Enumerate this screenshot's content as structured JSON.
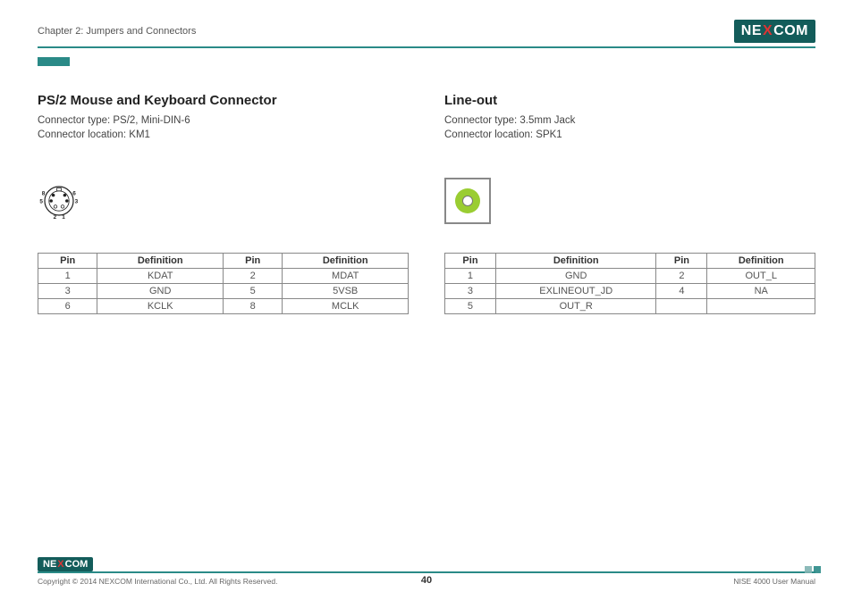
{
  "header": {
    "chapter_label": "Chapter 2: Jumpers and Connectors",
    "brand_left": "NE",
    "brand_x": "X",
    "brand_right": "COM"
  },
  "left_section": {
    "title": "PS/2 Mouse and Keyboard Connector",
    "connector_type": "Connector type: PS/2, Mini-DIN-6",
    "connector_location": "Connector location: KM1",
    "diagram_labels": {
      "p8": "8",
      "p6": "6",
      "p5": "5",
      "p3": "3",
      "p2": "2",
      "p1": "1"
    },
    "headers": {
      "pin": "Pin",
      "definition": "Definition"
    },
    "rows": [
      {
        "pin_a": "1",
        "def_a": "KDAT",
        "pin_b": "2",
        "def_b": "MDAT"
      },
      {
        "pin_a": "3",
        "def_a": "GND",
        "pin_b": "5",
        "def_b": "5VSB"
      },
      {
        "pin_a": "6",
        "def_a": "KCLK",
        "pin_b": "8",
        "def_b": "MCLK"
      }
    ]
  },
  "right_section": {
    "title": "Line-out",
    "connector_type": "Connector type: 3.5mm Jack",
    "connector_location": "Connector location: SPK1",
    "headers": {
      "pin": "Pin",
      "definition": "Definition"
    },
    "rows": [
      {
        "pin_a": "1",
        "def_a": "GND",
        "pin_b": "2",
        "def_b": "OUT_L"
      },
      {
        "pin_a": "3",
        "def_a": "EXLINEOUT_JD",
        "pin_b": "4",
        "def_b": "NA"
      },
      {
        "pin_a": "5",
        "def_a": "OUT_R",
        "pin_b": "",
        "def_b": ""
      }
    ]
  },
  "footer": {
    "copyright": "Copyright © 2014 NEXCOM International Co., Ltd. All Rights Reserved.",
    "page_number": "40",
    "manual_name": "NISE 4000 User Manual"
  },
  "colors": {
    "brand_bg": "#135c5a",
    "accent_rule": "#2a8a87",
    "jack_green": "#9ACD32"
  }
}
